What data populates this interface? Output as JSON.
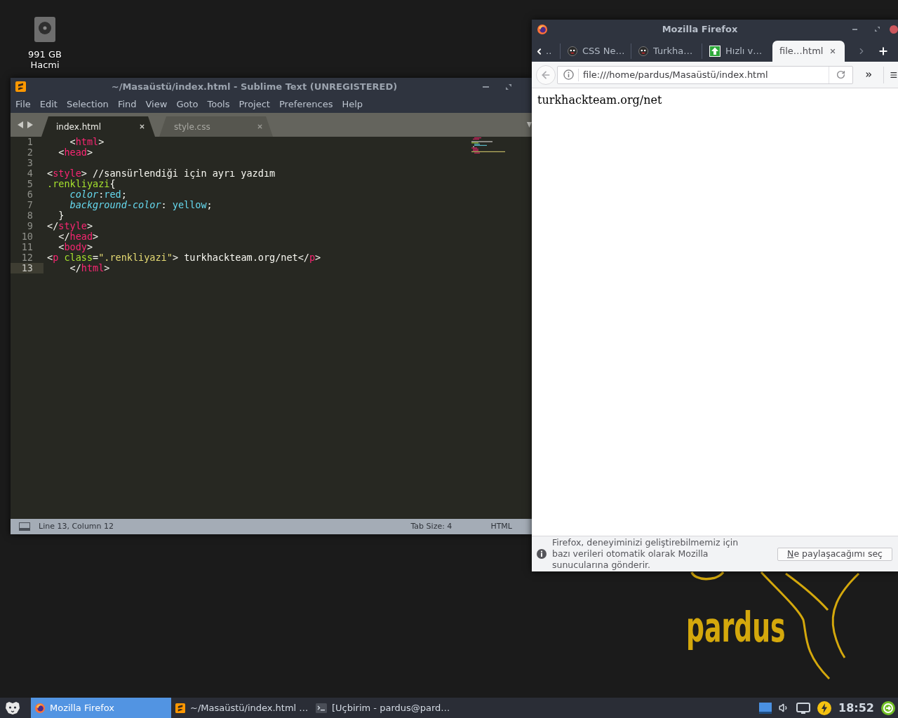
{
  "desktop": {
    "icons": [
      {
        "label": "991 GB Hacmi"
      }
    ],
    "wallpaper": {
      "wordmark": "pardus"
    }
  },
  "editor_window": {
    "title": "~/Masaüstü/index.html - Sublime Text (UNREGISTERED)",
    "menu": [
      "File",
      "Edit",
      "Selection",
      "Find",
      "View",
      "Goto",
      "Tools",
      "Project",
      "Preferences",
      "Help"
    ],
    "tabs": [
      {
        "label": "index.html",
        "selected": true
      },
      {
        "label": "style.css",
        "selected": false
      }
    ],
    "lines": [
      {
        "number": "1",
        "current": false,
        "tokens": [
          {
            "kind": "punct",
            "text": "    <"
          },
          {
            "kind": "tag",
            "text": "html"
          },
          {
            "kind": "punct",
            "text": ">"
          }
        ]
      },
      {
        "number": "2",
        "current": false,
        "tokens": [
          {
            "kind": "punct",
            "text": "  <"
          },
          {
            "kind": "tag",
            "text": "head"
          },
          {
            "kind": "punct",
            "text": ">"
          }
        ]
      },
      {
        "number": "3",
        "current": false
      },
      {
        "number": "4",
        "current": false,
        "tokens": [
          {
            "kind": "punct",
            "text": "<"
          },
          {
            "kind": "tag",
            "text": "style"
          },
          {
            "kind": "punct",
            "text": ">"
          },
          {
            "kind": "text",
            "text": " //sansürlendiği için ayrı yazdım"
          }
        ]
      },
      {
        "number": "5",
        "current": false,
        "tokens": [
          {
            "kind": "selector",
            "text": ".renkliyazi"
          },
          {
            "kind": "punct",
            "text": "{"
          }
        ]
      },
      {
        "number": "6",
        "current": false,
        "tokens": [
          {
            "kind": "property",
            "text": "    color"
          },
          {
            "kind": "punct",
            "text": ":"
          },
          {
            "kind": "value",
            "text": "red"
          },
          {
            "kind": "punct",
            "text": ";"
          }
        ]
      },
      {
        "number": "7",
        "current": false,
        "tokens": [
          {
            "kind": "property",
            "text": "    background-color"
          },
          {
            "kind": "punct",
            "text": ": "
          },
          {
            "kind": "value",
            "text": "yellow"
          },
          {
            "kind": "punct",
            "text": ";"
          }
        ]
      },
      {
        "number": "8",
        "current": false,
        "tokens": [
          {
            "kind": "punct",
            "text": "  }"
          }
        ]
      },
      {
        "number": "9",
        "current": false,
        "tokens": [
          {
            "kind": "punct",
            "text": "</"
          },
          {
            "kind": "tag",
            "text": "style"
          },
          {
            "kind": "punct",
            "text": ">"
          }
        ]
      },
      {
        "number": "10",
        "current": false,
        "tokens": [
          {
            "kind": "punct",
            "text": "  </"
          },
          {
            "kind": "tag",
            "text": "head"
          },
          {
            "kind": "punct",
            "text": ">"
          }
        ]
      },
      {
        "number": "11",
        "current": false,
        "tokens": [
          {
            "kind": "punct",
            "text": "  <"
          },
          {
            "kind": "tag",
            "text": "body"
          },
          {
            "kind": "punct",
            "text": ">"
          }
        ]
      },
      {
        "number": "12",
        "current": false,
        "tokens": [
          {
            "kind": "punct",
            "text": "<"
          },
          {
            "kind": "tag",
            "text": "p"
          },
          {
            "kind": "attr",
            "text": " class"
          },
          {
            "kind": "punct",
            "text": "="
          },
          {
            "kind": "string",
            "text": "\".renkliyazi\""
          },
          {
            "kind": "punct",
            "text": ">"
          },
          {
            "kind": "text",
            "text": " turkhackteam.org/net"
          },
          {
            "kind": "punct",
            "text": "</"
          },
          {
            "kind": "tag",
            "text": "p"
          },
          {
            "kind": "punct",
            "text": ">"
          }
        ]
      },
      {
        "number": "13",
        "current": true,
        "tokens": [
          {
            "kind": "punct",
            "text": "    </"
          },
          {
            "kind": "tag",
            "text": "html"
          },
          {
            "kind": "punct",
            "text": ">"
          }
        ]
      }
    ],
    "status_bar": {
      "position": "Line 13, Column 12",
      "tab_size": "Tab Size: 4",
      "syntax": "HTML"
    }
  },
  "browser_window": {
    "title": "Mozilla Firefox",
    "tabs": [
      {
        "kind": "clipped",
        "label": "..",
        "selected": false
      },
      {
        "kind": "mascot",
        "label": "CSS Ne…",
        "selected": false
      },
      {
        "kind": "mascot",
        "label": "Turkha…",
        "selected": false
      },
      {
        "kind": "upload",
        "label": "Hızlı v…",
        "selected": false
      },
      {
        "kind": "plain",
        "label": "file…html",
        "selected": true
      }
    ],
    "url": "file:///home/pardus/Masaüstü/index.html",
    "page_text": "turkhackteam.org/net",
    "notification": {
      "message": "Firefox, deneyiminizi geliştirebilmemiz için bazı verileri otomatik olarak Mozilla sunucularına gönderir.",
      "button_parts": [
        {
          "text": "N",
          "underlined": true
        },
        {
          "text": "e paylaşacağımı seç",
          "underlined": false
        }
      ]
    }
  },
  "taskbar": {
    "tasks": [
      {
        "kind": "browser",
        "label": "Mozilla Firefox",
        "selected": true
      },
      {
        "kind": "editor",
        "label": "~/Masaüstü/index.html …",
        "selected": false
      },
      {
        "kind": "terminal",
        "label": "[Uçbirim - pardus@pard…",
        "selected": false
      }
    ],
    "clock": "18:52"
  }
}
